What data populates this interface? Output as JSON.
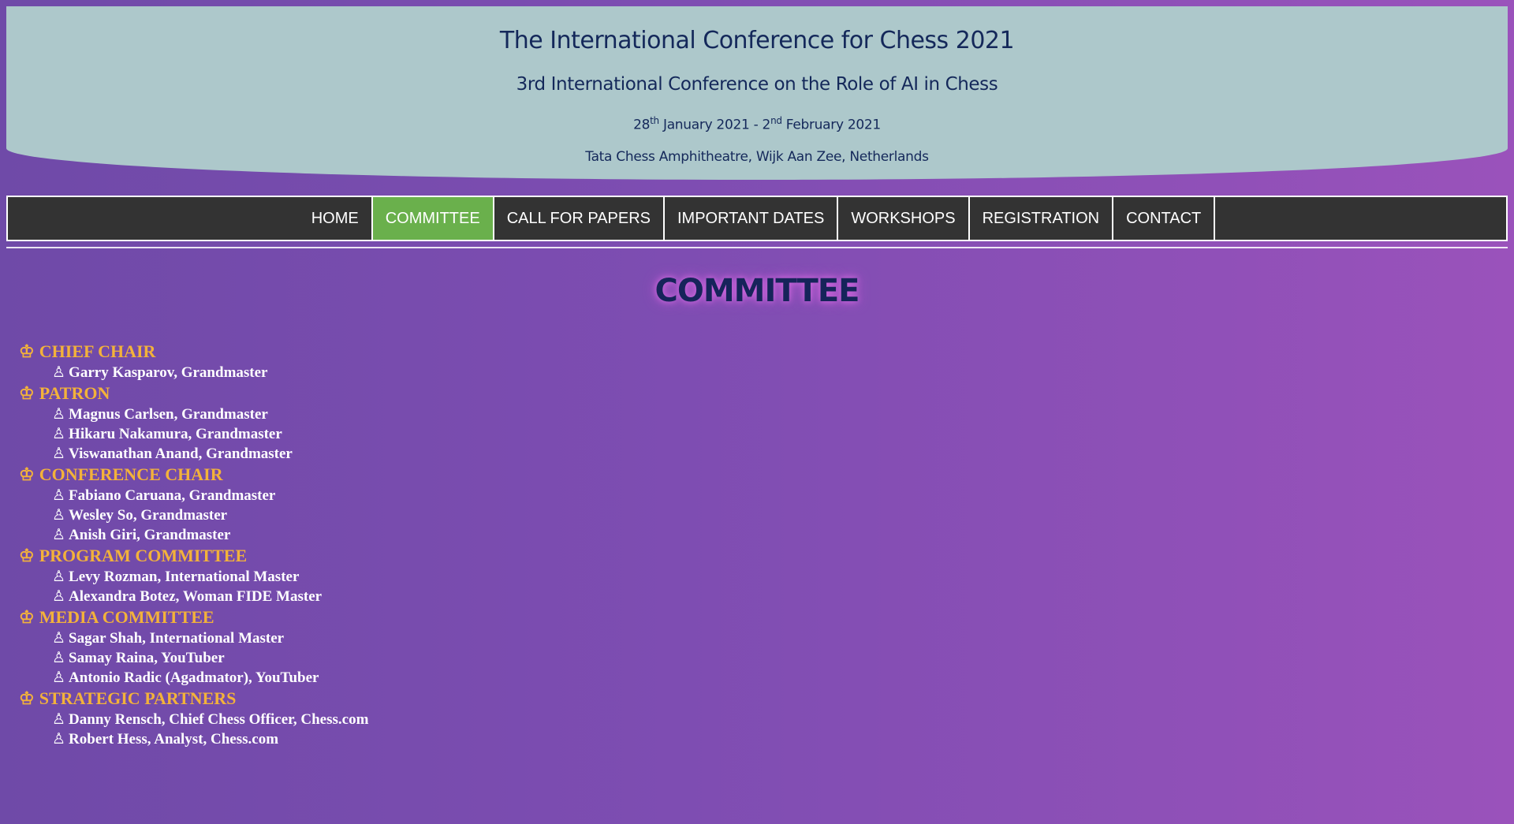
{
  "header": {
    "title": "The International Conference for Chess 2021",
    "subtitle": "3rd International Conference on the Role of AI in Chess",
    "dates": {
      "start_day": "28",
      "start_suffix": "th",
      "start_rest": " January 2021 - 2",
      "end_suffix": "nd",
      "end_rest": " February 2021"
    },
    "venue": "Tata Chess Amphitheatre, Wijk Aan Zee, Netherlands"
  },
  "nav": {
    "items": [
      {
        "label": "HOME"
      },
      {
        "label": "COMMITTEE",
        "active": true
      },
      {
        "label": "CALL FOR PAPERS"
      },
      {
        "label": "IMPORTANT DATES"
      },
      {
        "label": "WORKSHOPS"
      },
      {
        "label": "REGISTRATION"
      },
      {
        "label": "CONTACT"
      }
    ]
  },
  "page_title": "COMMITTEE",
  "icons": {
    "group_icon": "♔",
    "member_icon": "♙"
  },
  "colors": {
    "header_bg": "#adc8cb",
    "nav_bg": "#333333",
    "nav_active": "#6ab04c",
    "group_title": "#f3b23a",
    "title_text": "#16245a"
  },
  "committee": [
    {
      "title": "CHIEF CHAIR",
      "members": [
        "Garry Kasparov, Grandmaster"
      ]
    },
    {
      "title": "PATRON",
      "members": [
        "Magnus Carlsen, Grandmaster",
        "Hikaru Nakamura, Grandmaster",
        "Viswanathan Anand, Grandmaster"
      ]
    },
    {
      "title": "CONFERENCE CHAIR",
      "members": [
        "Fabiano Caruana, Grandmaster",
        "Wesley So, Grandmaster",
        "Anish Giri, Grandmaster"
      ]
    },
    {
      "title": "PROGRAM COMMITTEE",
      "members": [
        "Levy Rozman, International Master",
        "Alexandra Botez, Woman FIDE Master"
      ]
    },
    {
      "title": "MEDIA COMMITTEE",
      "members": [
        "Sagar Shah, International Master",
        "Samay Raina, YouTuber",
        "Antonio Radic (Agadmator), YouTuber"
      ]
    },
    {
      "title": "STRATEGIC PARTNERS",
      "members": [
        "Danny Rensch, Chief Chess Officer, Chess.com",
        "Robert Hess, Analyst, Chess.com"
      ]
    }
  ]
}
